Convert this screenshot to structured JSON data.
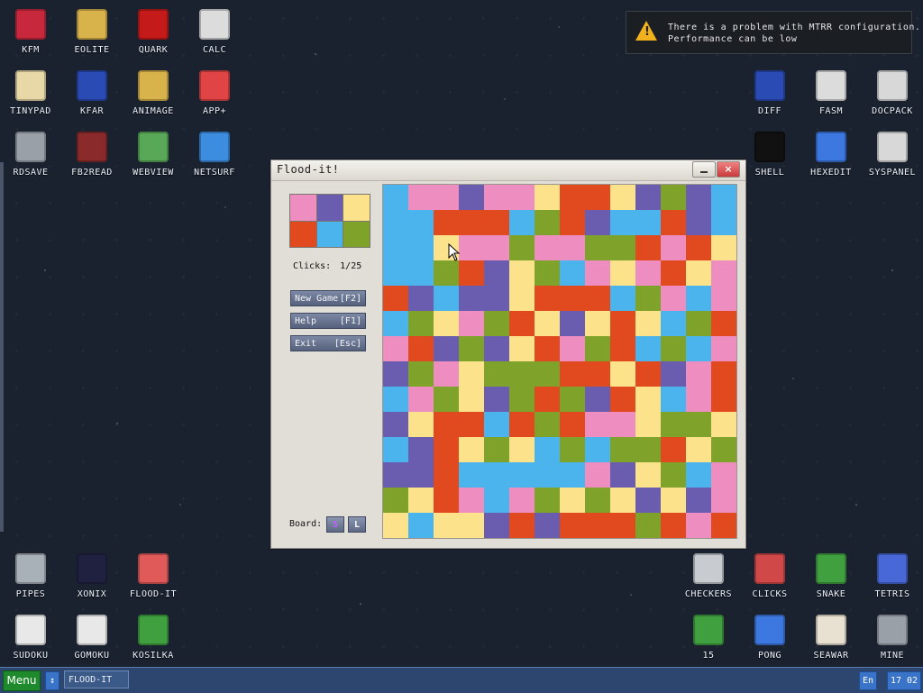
{
  "notification": {
    "line1": "There is a problem with MTRR configuration.",
    "line2": "Performance can be low"
  },
  "desktop_icons_left": [
    {
      "label": "KFM",
      "icon": "floppy-icon",
      "color": "#c8283c"
    },
    {
      "label": "EOLITE",
      "icon": "folder-icon",
      "color": "#d8b24a"
    },
    {
      "label": "QUARK",
      "icon": "notebook-icon",
      "color": "#c41a1a"
    },
    {
      "label": "CALC",
      "icon": "calculator-icon",
      "color": "#dcdcdc"
    },
    {
      "label": "TINYPAD",
      "icon": "notepad-icon",
      "color": "#e8d8a8"
    },
    {
      "label": "KFAR",
      "icon": "panels-icon",
      "color": "#2a4ab4"
    },
    {
      "label": "ANIMAGE",
      "icon": "pencil-ruler-icon",
      "color": "#d8b24a"
    },
    {
      "label": "APP+",
      "icon": "rubik-cube-icon",
      "color": "#e04444"
    },
    {
      "label": "RDSAVE",
      "icon": "disk-save-icon",
      "color": "#9aa0a8"
    },
    {
      "label": "FB2READ",
      "icon": "book-icon",
      "color": "#8a2a2a"
    },
    {
      "label": "WEBVIEW",
      "icon": "globe-page-icon",
      "color": "#58a858"
    },
    {
      "label": "NETSURF",
      "icon": "globe-icon",
      "color": "#3c8ce0"
    }
  ],
  "desktop_icons_right": [
    {
      "label": "DIFF",
      "icon": "diff-icon",
      "color": "#2a4ab4"
    },
    {
      "label": "FASM",
      "icon": "fasm-icon",
      "color": "#dcdcdc"
    },
    {
      "label": "DOCPACK",
      "icon": "cabinet-icon",
      "color": "#d8d8d8"
    },
    {
      "label": "SHELL",
      "icon": "terminal-icon",
      "color": "#111111"
    },
    {
      "label": "HEXEDIT",
      "icon": "hex-icon",
      "color": "#3c78e0"
    },
    {
      "label": "SYSPANEL",
      "icon": "sliders-icon",
      "color": "#d8d8d8"
    }
  ],
  "desktop_icons_bottom_left": [
    {
      "label": "PIPES",
      "icon": "pipes-icon",
      "color": "#a8b0b8"
    },
    {
      "label": "XONIX",
      "icon": "xonix-icon",
      "color": "#202040"
    },
    {
      "label": "FLOOD-IT",
      "icon": "flood-icon",
      "color": "#e05a5a"
    },
    {
      "label": "SUDOKU",
      "icon": "sudoku-icon",
      "color": "#e8e8e8"
    },
    {
      "label": "GOMOKU",
      "icon": "gomoku-icon",
      "color": "#e8e8e8"
    },
    {
      "label": "KOSILKA",
      "icon": "lawnmower-icon",
      "color": "#40a040"
    }
  ],
  "desktop_icons_bottom_right": [
    {
      "label": "CHECKERS",
      "icon": "checkers-icon",
      "color": "#c8ccd0"
    },
    {
      "label": "CLICKS",
      "icon": "clicks-icon",
      "color": "#d04848"
    },
    {
      "label": "SNAKE",
      "icon": "snake-icon",
      "color": "#40a040"
    },
    {
      "label": "TETRIS",
      "icon": "tetris-icon",
      "color": "#4868d8"
    },
    {
      "label": "15",
      "icon": "fifteen-icon",
      "color": "#40a040"
    },
    {
      "label": "PONG",
      "icon": "pong-icon",
      "color": "#3c78e0"
    },
    {
      "label": "SEAWAR",
      "icon": "seawar-icon",
      "color": "#e8e0d0"
    },
    {
      "label": "MINE",
      "icon": "mine-icon",
      "color": "#9aa0a8"
    }
  ],
  "window": {
    "title": "Flood-it!",
    "close_label": "×",
    "clicks_label": "Clicks:",
    "clicks_value": "1/25",
    "new_game_label": "New Game",
    "new_game_key": "[F2]",
    "help_label": "Help",
    "help_key": "[F1]",
    "exit_label": "Exit",
    "exit_key": "[Esc]",
    "board_label": "Board:",
    "size_s": "S",
    "size_l": "L"
  },
  "palette": {
    "P": "#ee8ec0",
    "U": "#6a5cae",
    "Y": "#fce28a",
    "R": "#e04a1e",
    "B": "#4cb4ec",
    "G": "#7fa22a"
  },
  "swatch_order": [
    "P",
    "U",
    "Y",
    "R",
    "B",
    "G"
  ],
  "board_rows": [
    "BPPUPPYRRYUGUB",
    "BBRRRBGRUBBRUB",
    "BBYPPGPPGGRPRY",
    "BBGRUYGBPYPRYP",
    "RUBUUYRRRBGPBP",
    "BGYPGRYUYRYBGR",
    "PRUGUYRPGRBGBP",
    "UGPYGGGRRYRUPR",
    "BPGYUGRGURYBPR",
    "UYRRBRGRPPYGGY",
    "BURYGYBGBGGRYG",
    "UURBBBBBPUYGBP",
    "GYRPBPGYGYUYUP",
    "YBYYURURRRGRPR"
  ],
  "taskbar": {
    "menu_label": "Menu",
    "switch_label": "↕",
    "task_label": "FLOOD-IT",
    "lang": "En",
    "time": "17 02"
  }
}
